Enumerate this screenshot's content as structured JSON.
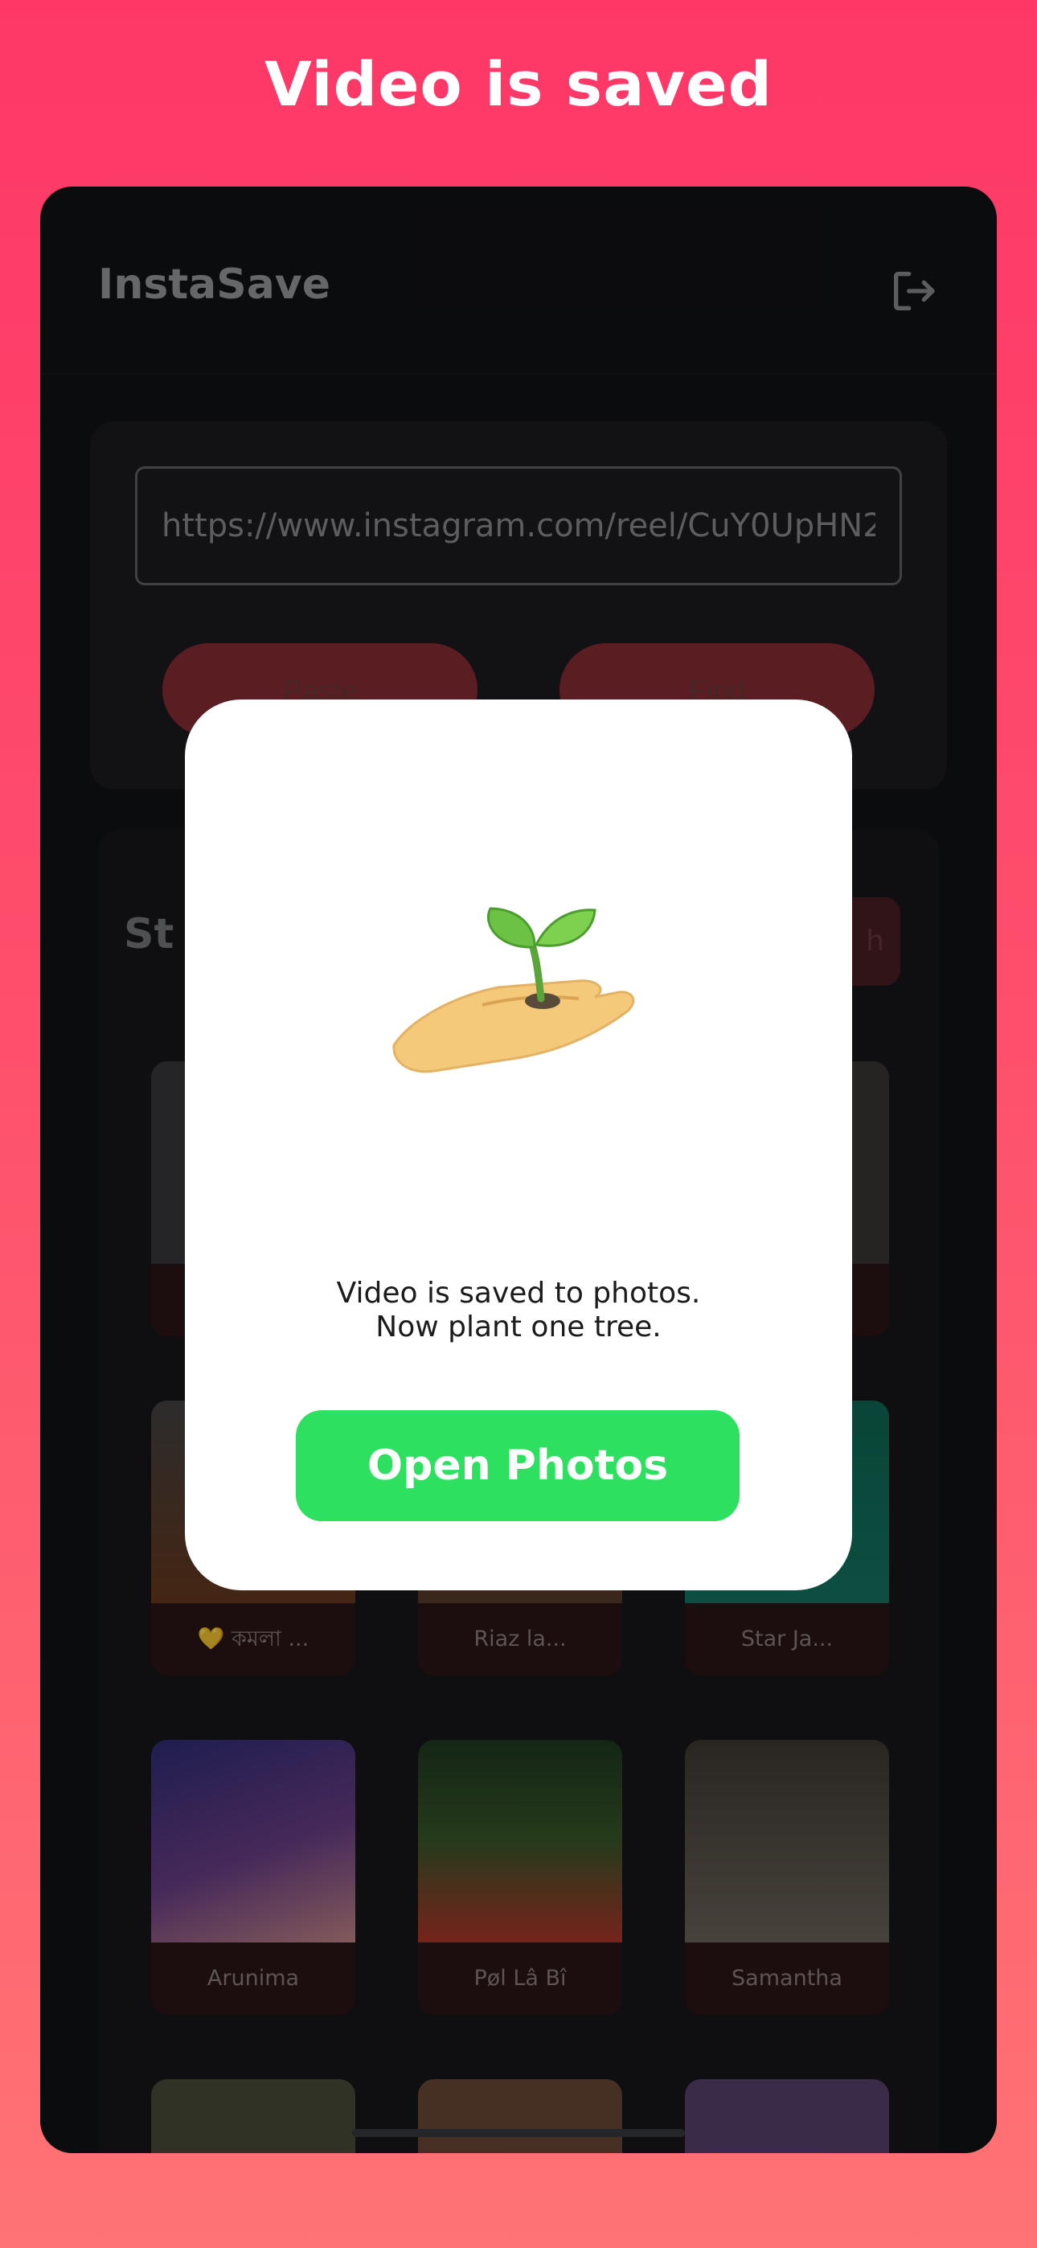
{
  "caption": "Video is saved",
  "app": {
    "title": "InstaSave",
    "logout_icon": "logout-icon"
  },
  "search": {
    "url_value": "https://www.instagram.com/reel/CuY0UpHN2",
    "paste_label": "Paste",
    "find_label": "Find"
  },
  "stories": {
    "title": "St",
    "refresh_label": "h",
    "tiles": [
      {
        "name": ""
      },
      {
        "name": ""
      },
      {
        "name": ""
      },
      {
        "name": "💛 কমলা ..."
      },
      {
        "name": "Riaz la..."
      },
      {
        "name": "Star Ja..."
      },
      {
        "name": "Arunima"
      },
      {
        "name": "Pøl Lâ Bî"
      },
      {
        "name": "Samantha"
      },
      {
        "name": ""
      },
      {
        "name": ""
      },
      {
        "name": ""
      }
    ]
  },
  "modal": {
    "illustration": "hand-holding-sprout",
    "message_line1": "Video is saved to photos.",
    "message_line2": "Now plant one tree.",
    "button_label": "Open Photos"
  },
  "colors": {
    "accent": "#fe3767",
    "button_green": "#2ee060",
    "app_bg": "#121316"
  }
}
